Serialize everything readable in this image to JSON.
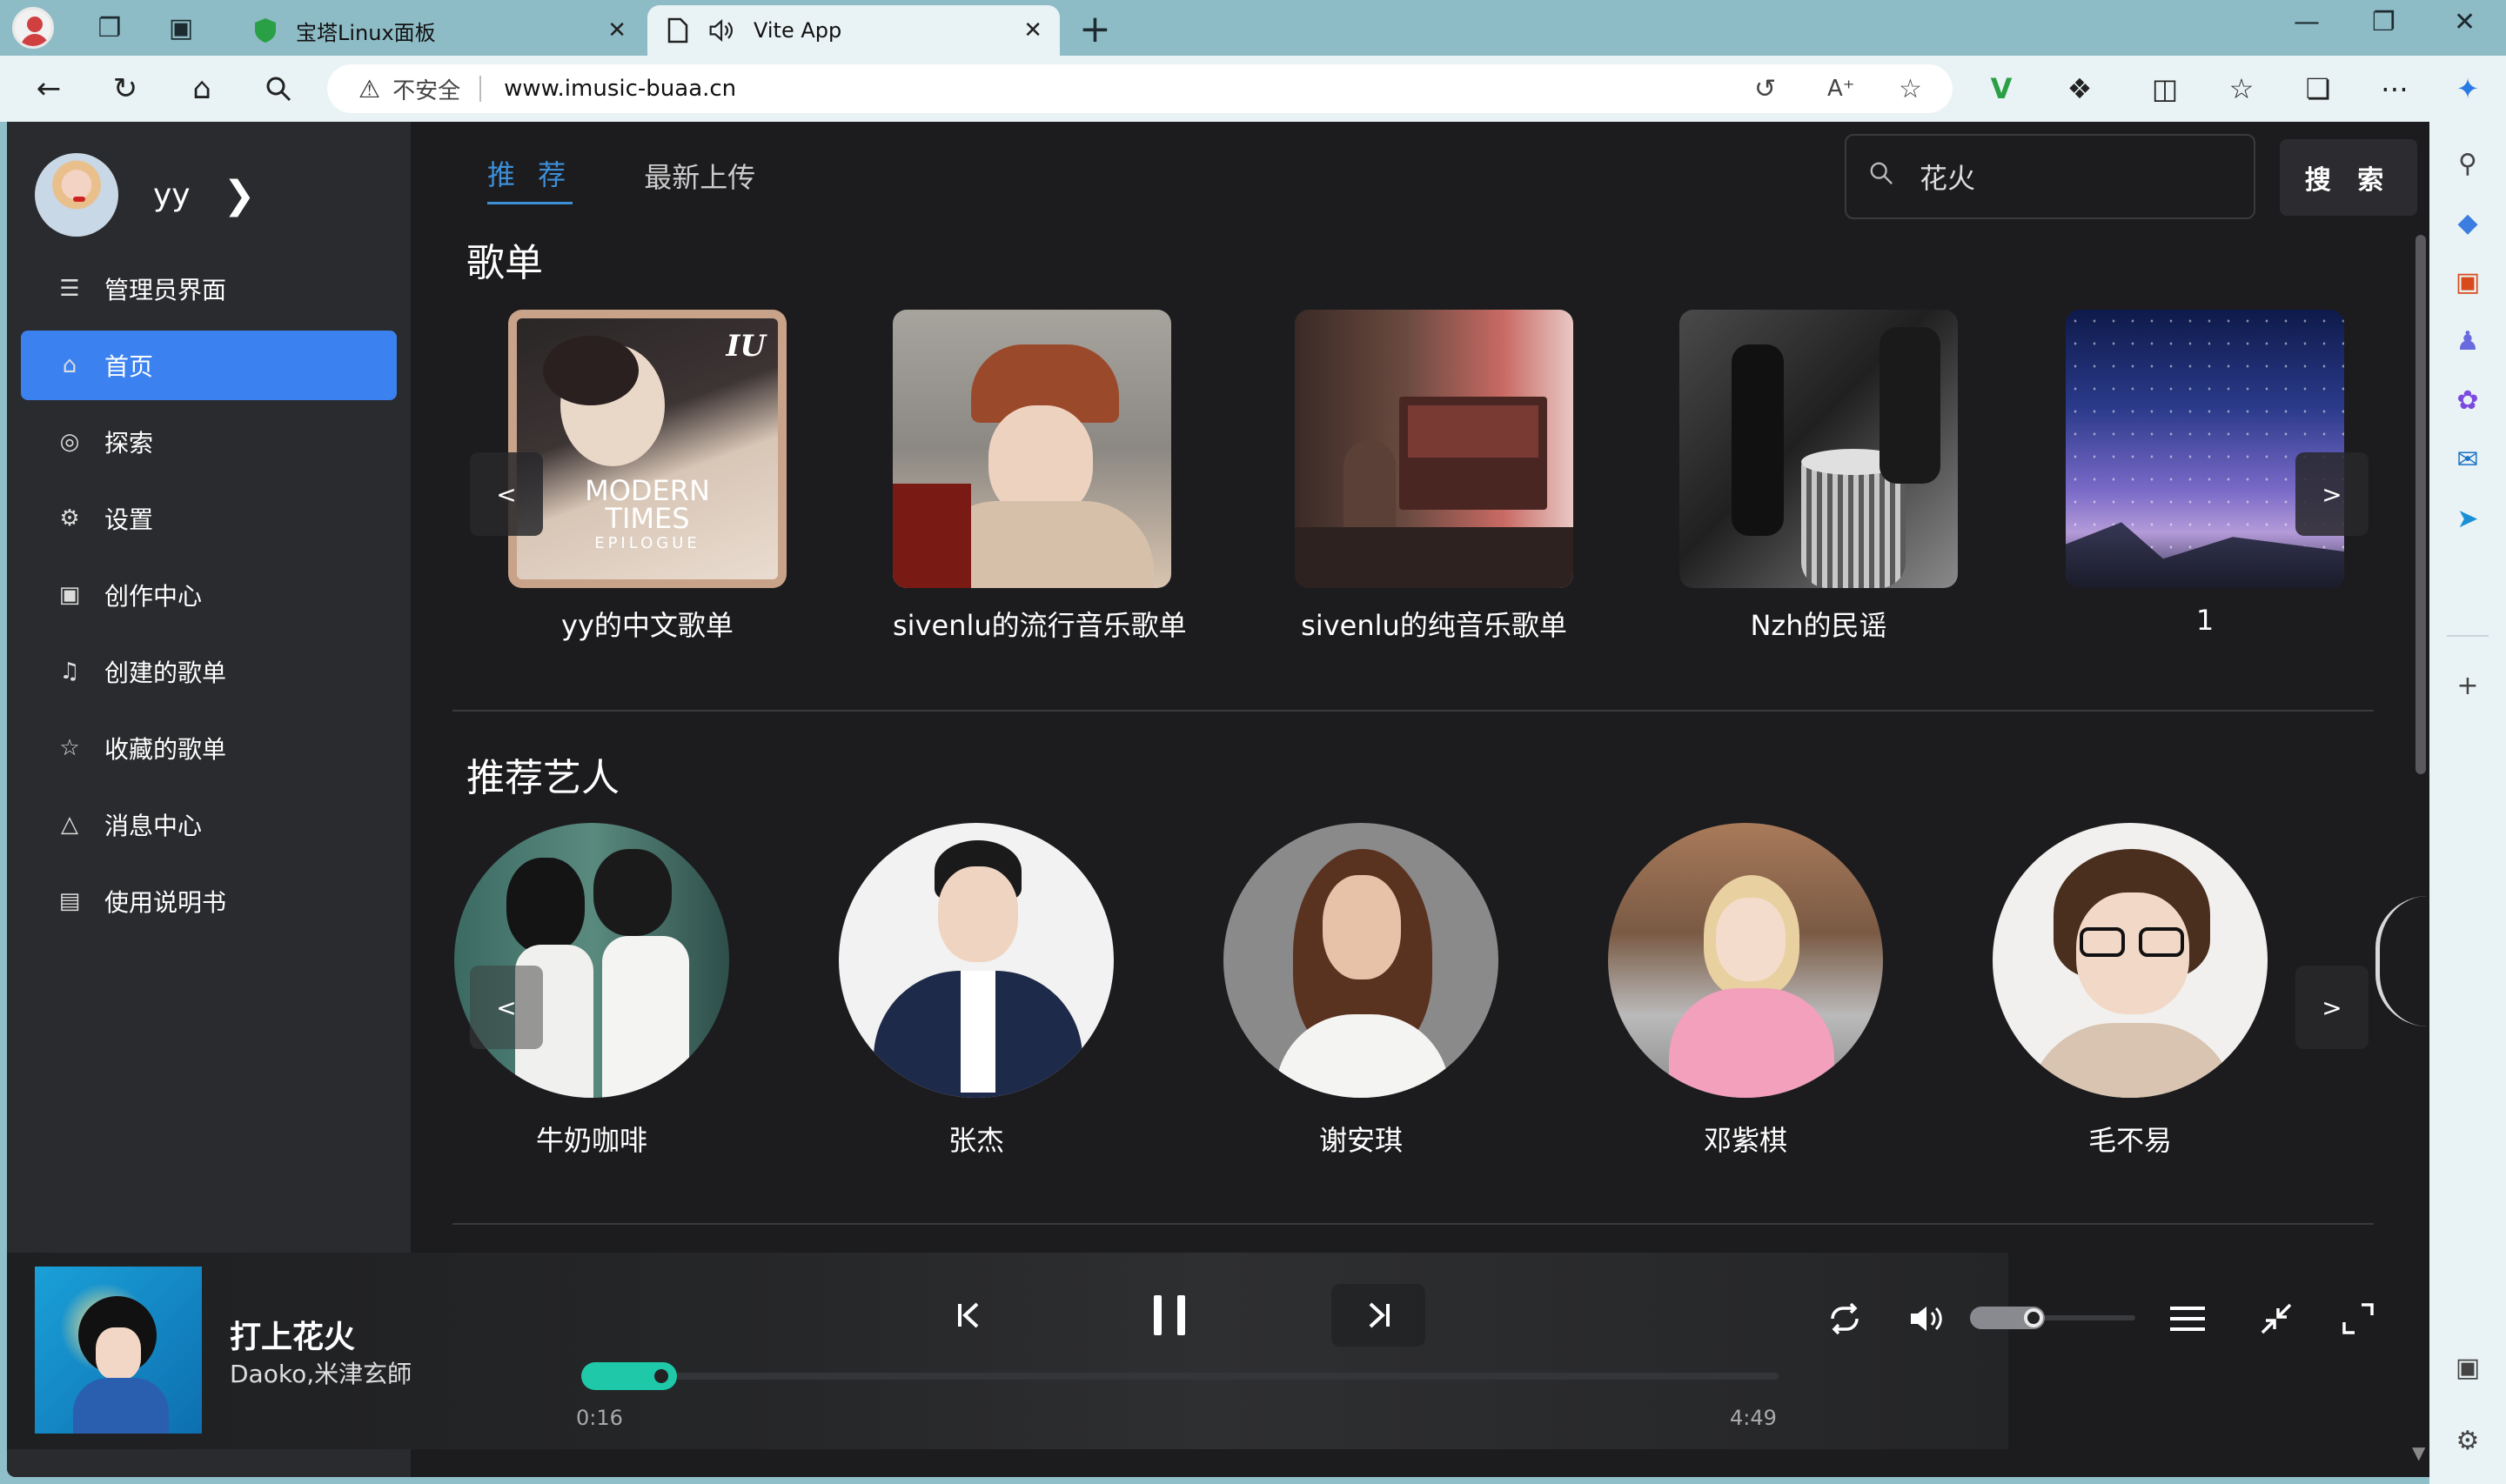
{
  "browser": {
    "tabs": [
      {
        "label": "宝塔Linux面板",
        "active": false
      },
      {
        "label": "Vite App",
        "active": true
      }
    ],
    "address": {
      "security_label": "不安全",
      "url": "www.imusic-buaa.cn"
    }
  },
  "sidebar": {
    "user": {
      "name": "yy"
    },
    "items": [
      {
        "label": "管理员界面",
        "icon": "admin-list-icon",
        "active": false
      },
      {
        "label": "首页",
        "icon": "home-icon",
        "active": true
      },
      {
        "label": "探索",
        "icon": "compass-icon",
        "active": false
      },
      {
        "label": "设置",
        "icon": "gear-icon",
        "active": false
      },
      {
        "label": "创作中心",
        "icon": "gift-icon",
        "active": false
      },
      {
        "label": "创建的歌单",
        "icon": "music-file-icon",
        "active": false
      },
      {
        "label": "收藏的歌单",
        "icon": "star-icon",
        "active": false
      },
      {
        "label": "消息中心",
        "icon": "bell-icon",
        "active": false
      },
      {
        "label": "使用说明书",
        "icon": "document-icon",
        "active": false
      }
    ]
  },
  "main": {
    "tabs": [
      {
        "label": "推 荐",
        "active": true
      },
      {
        "label": "最新上传",
        "active": false
      }
    ],
    "search": {
      "value": "花火",
      "button_label": "搜 索"
    },
    "playlists_section": {
      "title": "歌单",
      "items": [
        {
          "title": "yy的中文歌单",
          "cover_text": [
            "MODERN",
            "TIMES",
            "EPILOGUE"
          ],
          "badge": "IU"
        },
        {
          "title": "sivenlu的流行音乐歌单"
        },
        {
          "title": "sivenlu的纯音乐歌单"
        },
        {
          "title": "Nzh的民谣"
        },
        {
          "title": "1"
        }
      ]
    },
    "artists_section": {
      "title": "推荐艺人",
      "items": [
        {
          "name": "牛奶咖啡"
        },
        {
          "name": "张杰"
        },
        {
          "name": "谢安琪"
        },
        {
          "name": "邓紫棋"
        },
        {
          "name": "毛不易"
        }
      ]
    },
    "carousel": {
      "prev": "<",
      "next": ">"
    }
  },
  "player": {
    "title": "打上花火",
    "artist": "Daoko,米津玄師",
    "current_time": "0:16",
    "total_time": "4:49",
    "progress": 0.056,
    "volume": 0.45
  },
  "colors": {
    "accent": "#3b82f0",
    "progress": "#1ec8a8",
    "app_bg": "#1c1c1e",
    "sidebar_bg": "#2a2b2e"
  }
}
